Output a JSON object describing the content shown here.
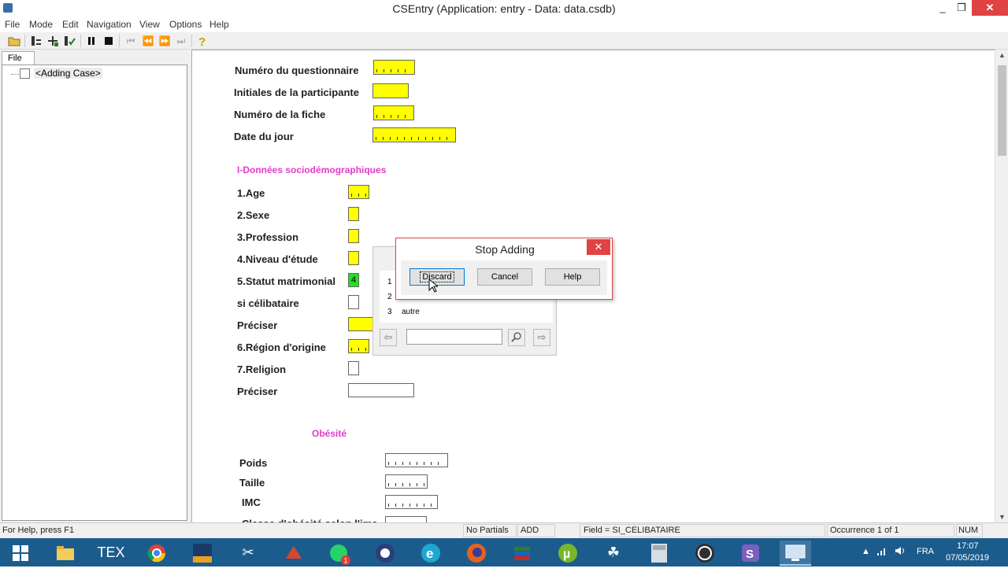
{
  "window": {
    "title": "CSEntry (Application: entry - Data: data.csdb)",
    "minimize": "_",
    "maximize": "❐",
    "close": "✕"
  },
  "menu": [
    "File",
    "Mode",
    "Edit",
    "Navigation",
    "View",
    "Options",
    "Help"
  ],
  "tree": {
    "tab": "File",
    "item": "<Adding Case>"
  },
  "form": {
    "fields": {
      "numero_questionnaire": "Numéro du questionnaire",
      "initiales": "Initiales de la participante",
      "numero_fiche": "Numéro de la fiche",
      "date_jour": "Date du jour"
    },
    "section1": "I-Données sociodémographiques",
    "items": {
      "age": "1.Age",
      "sexe": "2.Sexe",
      "profession": "3.Profession",
      "niveau": "4.Niveau d'étude",
      "statut": "5.Statut matrimonial",
      "statut_value": "4",
      "celibataire": "si célibataire",
      "preciser1": "Préciser",
      "region": "6.Région d'origine",
      "religion": "7.Religion",
      "preciser2": "Préciser"
    },
    "section2": "Obésité",
    "obesite": {
      "poids": "Poids",
      "taille": "Taille",
      "imc": "IMC",
      "cut": "Classe d'obésité selon l'imc"
    }
  },
  "valueset": {
    "rows": [
      {
        "code": "1",
        "label": ""
      },
      {
        "code": "2",
        "label": ""
      },
      {
        "code": "3",
        "label": "autre"
      }
    ]
  },
  "dialog": {
    "title": "Stop Adding",
    "close": "✕",
    "buttons": [
      "Discard",
      "Cancel",
      "Help"
    ]
  },
  "status": {
    "help": "For Help, press F1",
    "partials": "No Partials",
    "mode": "ADD",
    "field": "Field = SI_CELIBATAIRE",
    "occurrence": "Occurrence 1 of 1",
    "num": "NUM"
  },
  "tray": {
    "lang": "FRA",
    "time": "17:07",
    "date": "07/05/2019",
    "badge": "1"
  },
  "colors": {
    "field_yellow": "#ffff00",
    "field_green": "#22e022",
    "section_magenta": "#e23cc7",
    "taskbar": "#1c5c8d",
    "close_red": "#e04343"
  }
}
